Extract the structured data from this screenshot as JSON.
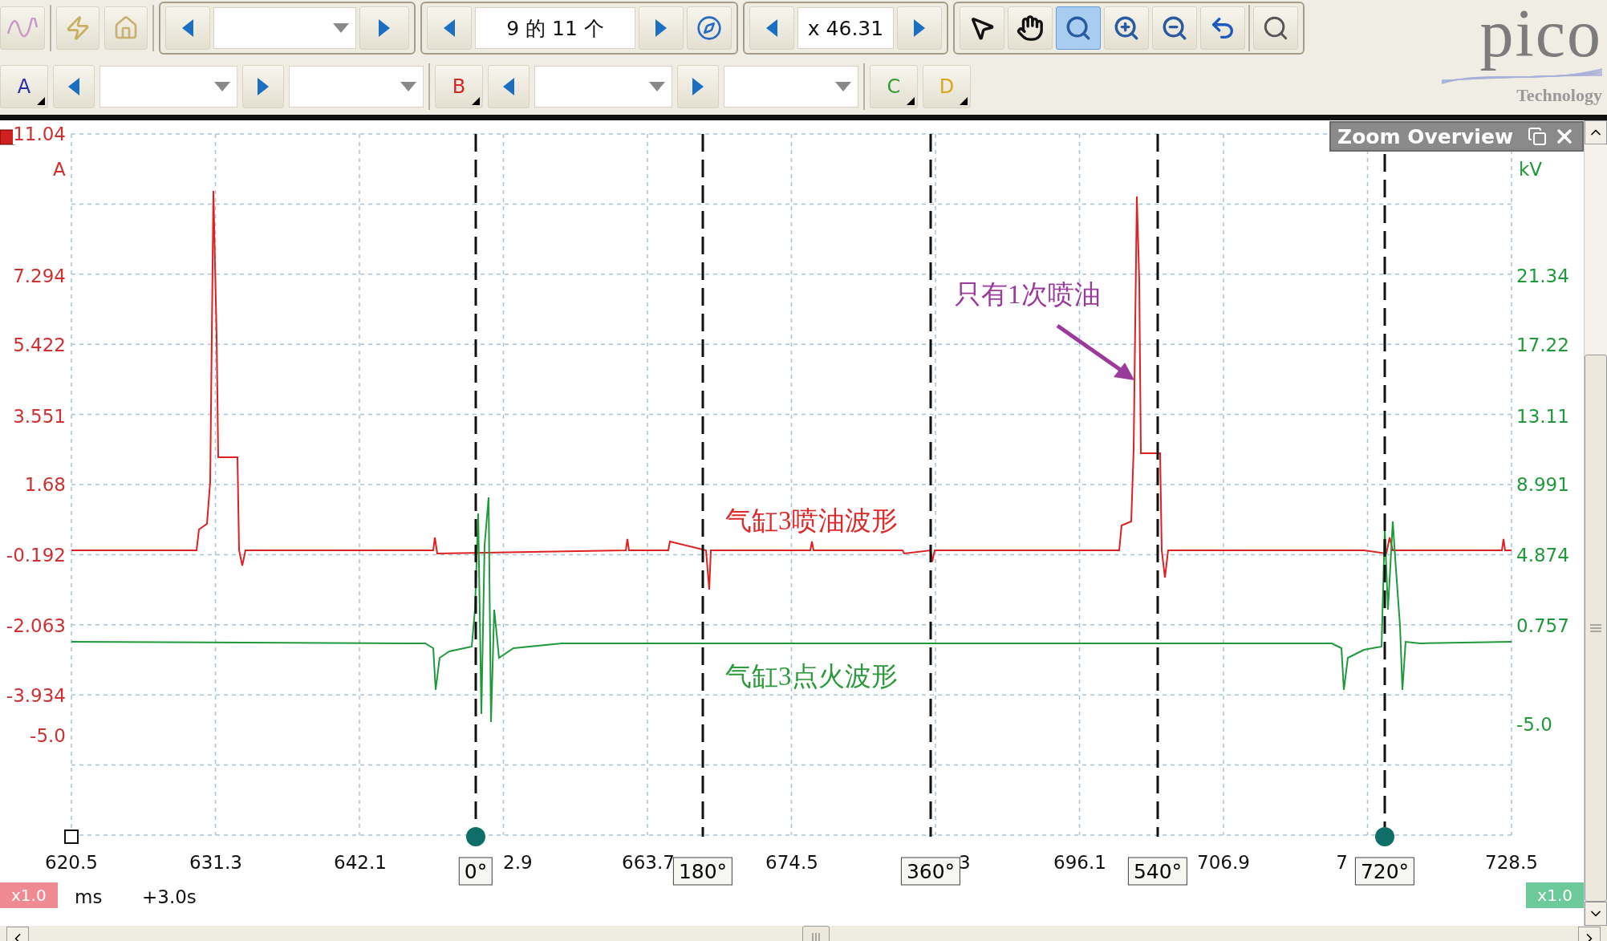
{
  "toolbar": {
    "page_counter": "9 的 11 个",
    "zoom_factor": "x 46.31",
    "tools": [
      {
        "kind": "pointer",
        "selected": false
      },
      {
        "kind": "hand",
        "selected": false
      },
      {
        "kind": "zoom-region",
        "selected": true
      },
      {
        "kind": "zoom-in",
        "selected": false
      },
      {
        "kind": "zoom-out",
        "selected": false
      },
      {
        "kind": "undo",
        "selected": false
      }
    ],
    "channels": [
      {
        "label": "A",
        "color": "#2b2ba8"
      },
      {
        "label": "B",
        "color": "#d02828"
      },
      {
        "label": "C",
        "color": "#2f9a2f"
      },
      {
        "label": "D",
        "color": "#d8a818"
      }
    ]
  },
  "logo": {
    "name": "pico",
    "tagline": "Technology"
  },
  "zoom_overview": {
    "title": "Zoom Overview"
  },
  "plot": {
    "left_axis": {
      "unit": "A",
      "ticks": [
        "11.04",
        "7.294",
        "5.422",
        "3.551",
        "1.68",
        "-0.192",
        "-2.063",
        "-3.934",
        "-5.0"
      ]
    },
    "right_axis": {
      "unit": "kV",
      "ticks": [
        "21.34",
        "17.22",
        "13.11",
        "8.991",
        "4.874",
        "0.757",
        "-5.0"
      ]
    },
    "x_axis": {
      "ticks": [
        "620.5",
        "631.3",
        "642.1",
        "2.9",
        "663.7",
        "674.5",
        "3",
        "696.1",
        "706.9",
        "7",
        "728.5"
      ],
      "unit": "ms",
      "offset": "+3.0s",
      "left_scale": "x1.0",
      "right_scale": "x1.0"
    },
    "cursors": [
      {
        "label": "0°",
        "kind": "handle"
      },
      {
        "label": "180°",
        "kind": "plain"
      },
      {
        "label": "360°",
        "kind": "plain"
      },
      {
        "label": "540°",
        "kind": "plain"
      },
      {
        "label": "720°",
        "kind": "handle"
      }
    ],
    "annotations": [
      {
        "kind": "callout",
        "text": "只有1次喷油",
        "color": "#9a3a9a"
      },
      {
        "kind": "label",
        "text": "气缸3喷油波形",
        "color": "#e02828"
      },
      {
        "kind": "label",
        "text": "气缸3点火波形",
        "color": "#2a9a3a"
      }
    ]
  }
}
